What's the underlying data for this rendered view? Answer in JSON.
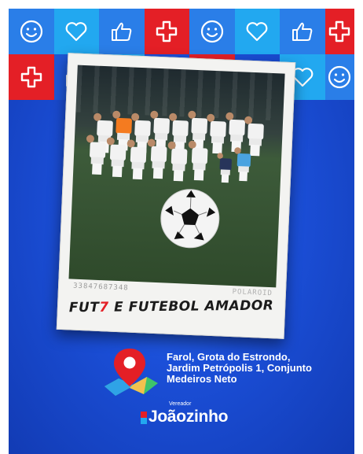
{
  "tiles": [
    {
      "icon": "smiley-icon",
      "color": "#2a7ee8"
    },
    {
      "icon": "heart-icon",
      "color": "#22a8f0"
    },
    {
      "icon": "thumbs-up-icon",
      "color": "#2a7ee8"
    },
    {
      "icon": "cross-icon",
      "color": "#e41f26"
    },
    {
      "icon": "smiley-icon",
      "color": "#2a7ee8"
    },
    {
      "icon": "heart-icon",
      "color": "#22a8f0"
    },
    {
      "icon": "thumbs-up-icon",
      "color": "#2a7ee8"
    },
    {
      "icon": "cross-icon",
      "color": "#e41f26"
    },
    {
      "icon": "cross-icon",
      "color": "#e41f26"
    },
    {
      "icon": "thumbs-up-icon",
      "color": "#1e57d6"
    },
    {
      "icon": "heart-icon",
      "color": "#22a8f0"
    },
    {
      "icon": "heart-icon",
      "color": "#22a8f0"
    },
    {
      "icon": "smiley-icon",
      "color": "#2a7ee8"
    }
  ],
  "photo": {
    "stamp_left": "33847687348",
    "stamp_right": "POLAROID"
  },
  "caption": {
    "part1": "FUT",
    "accent": "7",
    "part2": " E FUTEBOL AMADOR"
  },
  "address": {
    "lines": [
      "Farol, Grota do Estrondo,",
      "Jardim Petrópolis 1, Conjunto",
      "Medeiros Neto"
    ]
  },
  "brand": {
    "subtitle": "Vereador",
    "name": "Joãozinho"
  },
  "colors": {
    "background": "#1b4fd8",
    "red": "#e41f26",
    "sky": "#22a8f0"
  }
}
